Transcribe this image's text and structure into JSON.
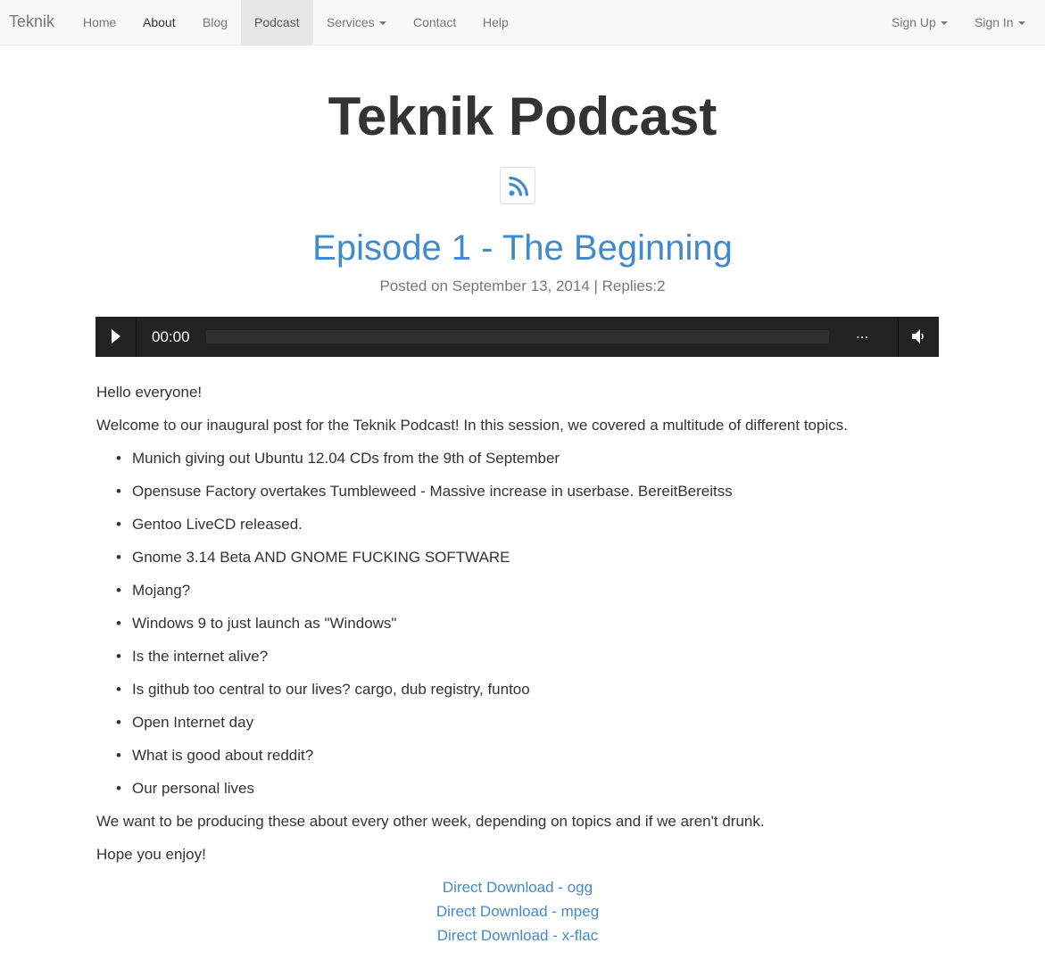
{
  "navbar": {
    "brand": "Teknik",
    "items": [
      {
        "label": "Home"
      },
      {
        "label": "About"
      },
      {
        "label": "Blog"
      },
      {
        "label": "Podcast"
      },
      {
        "label": "Services"
      },
      {
        "label": "Contact"
      },
      {
        "label": "Help"
      }
    ],
    "right": [
      {
        "label": "Sign Up"
      },
      {
        "label": "Sign In"
      }
    ]
  },
  "header": {
    "title": "Teknik Podcast",
    "rss_icon": "rss-icon"
  },
  "episode": {
    "title": "Episode 1 - The Beginning",
    "posted": "Posted on September 13, 2014 | Replies:2"
  },
  "player": {
    "time": "00:00",
    "more": "...",
    "play_icon": "play-icon",
    "volume_icon": "volume-icon"
  },
  "content": {
    "greeting": "Hello everyone!",
    "intro": "Welcome to our inaugural post for the Teknik Podcast! In this session, we covered a multitude of different topics.",
    "topics": [
      "Munich giving out Ubuntu 12.04 CDs from the 9th of September",
      "Opensuse Factory overtakes Tumbleweed - Massive increase in userbase. BereitBereitss",
      "Gentoo LiveCD released.",
      "Gnome 3.14 Beta AND GNOME FUCKING SOFTWARE",
      "Mojang?",
      "Windows 9 to just launch as \"Windows\"",
      "Is the internet alive?",
      "Is github too central to our lives? cargo, dub registry, funtoo",
      "Open Internet day",
      "What is good about reddit?",
      "Our personal lives"
    ],
    "outro": "We want to be producing these about every other week, depending on topics and if we aren't drunk.",
    "closing": "Hope you enjoy!"
  },
  "downloads": [
    {
      "label": "Direct Download - ogg"
    },
    {
      "label": "Direct Download - mpeg"
    },
    {
      "label": "Direct Download - x-flac"
    }
  ],
  "colors": {
    "link": "#428bca",
    "navbar_bg": "#f8f8f8",
    "player_bg": "#222222"
  }
}
